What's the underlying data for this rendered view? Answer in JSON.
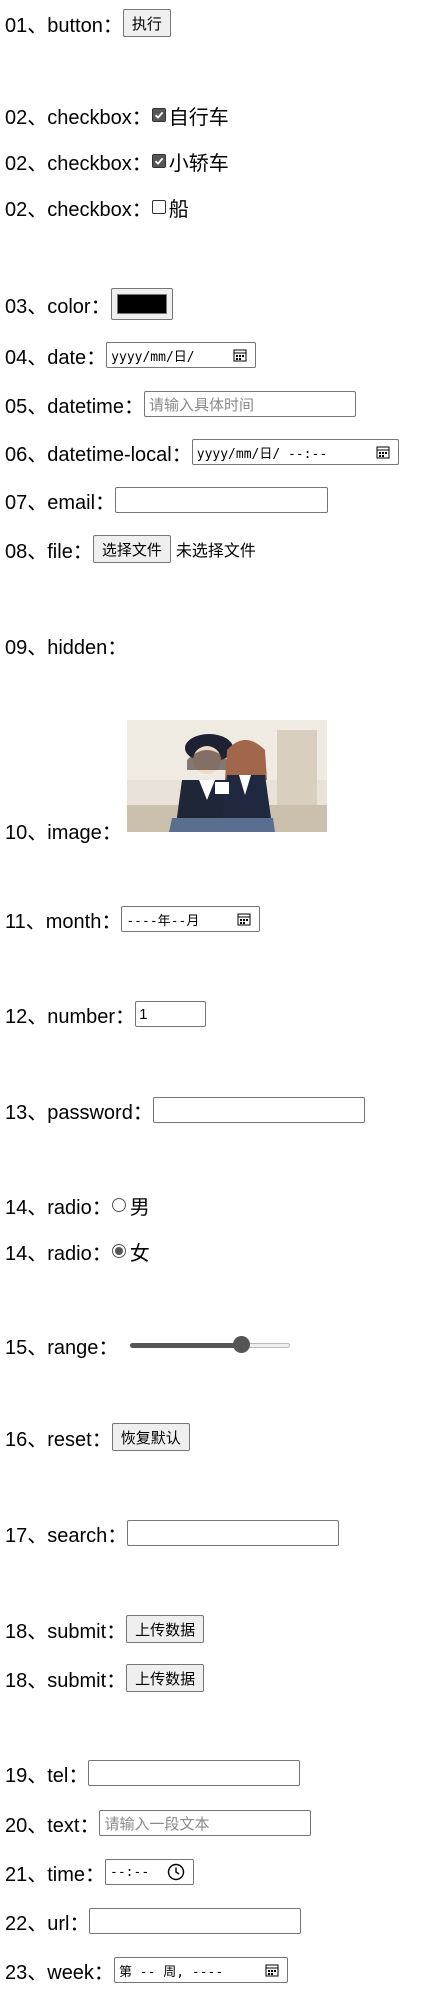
{
  "rows": {
    "button": {
      "label": "01、button：",
      "value": "执行"
    },
    "checkbox": [
      {
        "label": "02、checkbox：",
        "option": "自行车",
        "checked": true
      },
      {
        "label": "02、checkbox：",
        "option": "小轿车",
        "checked": true
      },
      {
        "label": "02、checkbox：",
        "option": "船",
        "checked": false
      }
    ],
    "color": {
      "label": "03、color：",
      "value": "#000000"
    },
    "date": {
      "label": "04、date：",
      "value": "yyyy/mm/日/"
    },
    "datetime": {
      "label": "05、datetime：",
      "placeholder": "请输入具体时间"
    },
    "datetime_local": {
      "label": "06、datetime-local：",
      "value": "yyyy/mm/日/ --:--"
    },
    "email": {
      "label": "07、email："
    },
    "file": {
      "label": "08、file：",
      "button": "选择文件",
      "status": "未选择文件"
    },
    "hidden": {
      "label": "09、hidden："
    },
    "image": {
      "label": "10、image："
    },
    "month": {
      "label": "11、month：",
      "value": "----年--月"
    },
    "number": {
      "label": "12、number：",
      "value": "1"
    },
    "password": {
      "label": "13、password："
    },
    "radio": [
      {
        "label": "14、radio：",
        "option": "男",
        "checked": false
      },
      {
        "label": "14、radio：",
        "option": "女",
        "checked": true
      }
    ],
    "range": {
      "label": "15、range：",
      "value": 0.72
    },
    "reset": {
      "label": "16、reset：",
      "value": "恢复默认"
    },
    "search": {
      "label": "17、search："
    },
    "submit": [
      {
        "label": "18、submit：",
        "value": "上传数据"
      },
      {
        "label": "18、submit：",
        "value": "上传数据"
      }
    ],
    "tel": {
      "label": "19、tel："
    },
    "text": {
      "label": "20、text：",
      "placeholder": "请输入一段文本"
    },
    "time": {
      "label": "21、time：",
      "value": "--:--"
    },
    "url": {
      "label": "22、url："
    },
    "week": {
      "label": "23、week：",
      "value": "第 -- 周, ----"
    }
  },
  "icons": {
    "calendar": "calendar-icon",
    "clock": "clock-icon",
    "checkmark": "check-icon"
  },
  "colors": {
    "control_border": "#767676",
    "button_bg": "#efefef",
    "placeholder": "#8a8a8a",
    "range_active": "#555555"
  }
}
